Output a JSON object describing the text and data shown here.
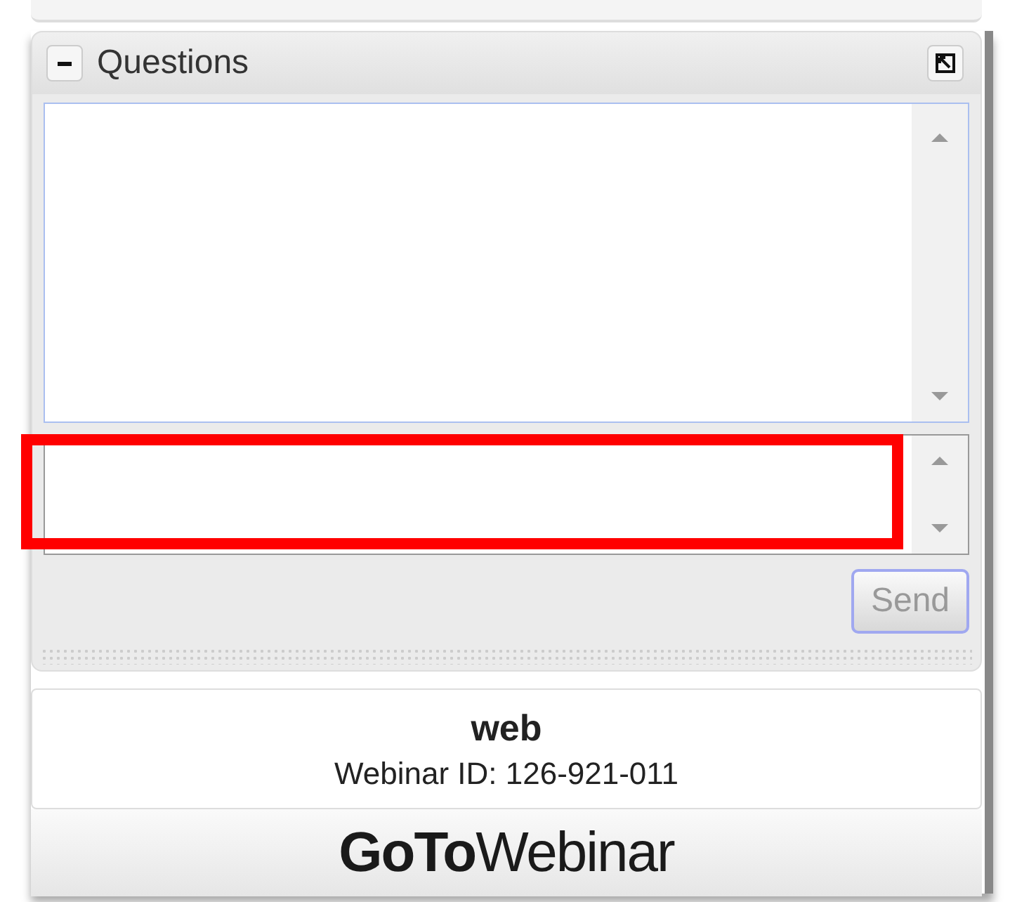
{
  "questions_panel": {
    "title": "Questions",
    "collapsed": false
  },
  "send_button": {
    "label": "Send",
    "disabled": true
  },
  "webinar_info": {
    "name": "web",
    "id_line": "Webinar ID: 126-921-011"
  },
  "logo": "**GoTo**Webinar"
}
